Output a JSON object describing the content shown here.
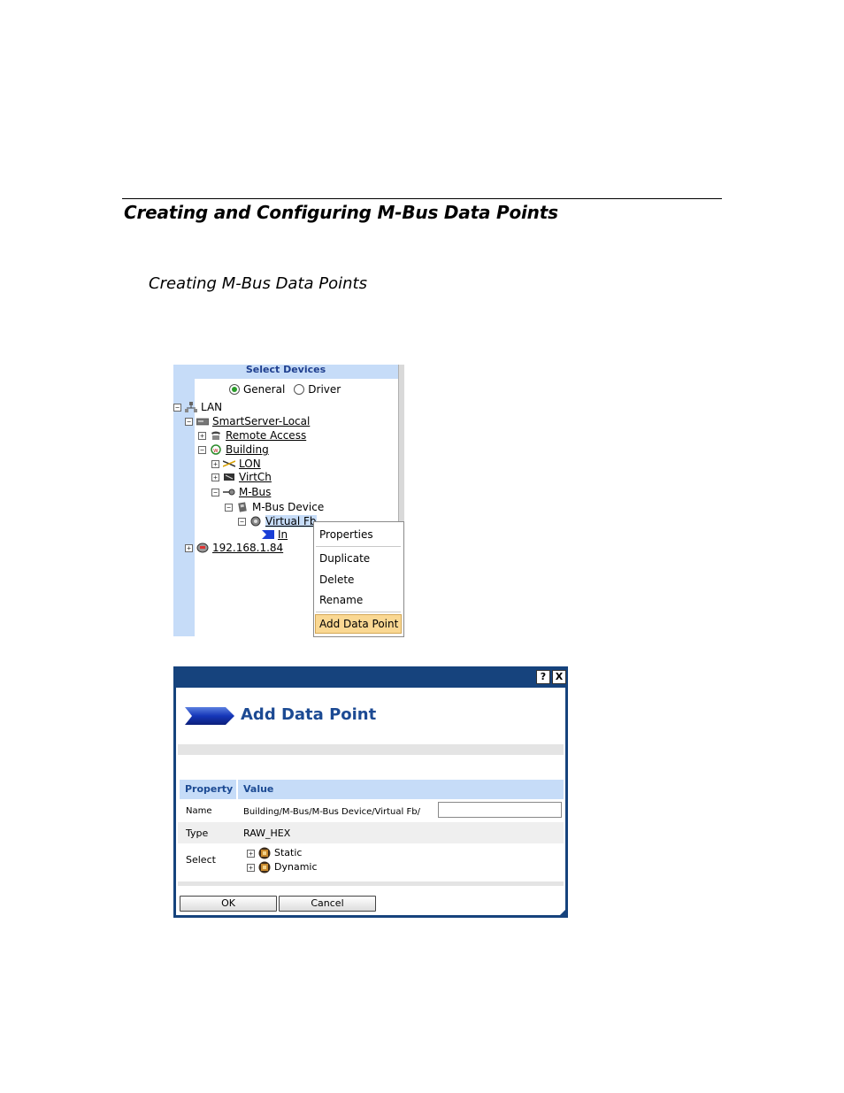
{
  "doc": {
    "heading1": "Creating and Configuring M-Bus Data Points",
    "heading2": "Creating M-Bus Data Points"
  },
  "select_devices": {
    "header": "Select Devices",
    "radio_general": "General",
    "radio_driver": "Driver",
    "radio_selected": "General",
    "tree": {
      "lan": "LAN",
      "smartserver": "SmartServer-Local",
      "remote_access": "Remote Access",
      "building": "Building",
      "lon": "LON",
      "virtch": "VirtCh",
      "mbus": "M-Bus",
      "mbus_device": "M-Bus Device",
      "virtual_fb": "Virtual Fb",
      "in": "In",
      "ip": "192.168.1.84"
    }
  },
  "context_menu": {
    "items": [
      "Properties",
      "Duplicate",
      "Delete",
      "Rename",
      "Add Data Point"
    ],
    "highlighted": "Add Data Point"
  },
  "dialog": {
    "title": "Add Data Point",
    "help_icon": "?",
    "close_icon": "X",
    "col_property": "Property",
    "col_value": "Value",
    "rows": {
      "name_label": "Name",
      "name_value": "Building/M-Bus/M-Bus Device/Virtual Fb/",
      "name_input": "",
      "type_label": "Type",
      "type_value": "RAW_HEX",
      "select_label": "Select",
      "select_static": "Static",
      "select_dynamic": "Dynamic"
    },
    "ok_label": "OK",
    "cancel_label": "Cancel"
  },
  "colors": {
    "panel_blue": "#c6dcf8",
    "dialog_frame": "#16437d",
    "title_blue": "#1c4a93",
    "menu_highlight": "#fad893"
  }
}
